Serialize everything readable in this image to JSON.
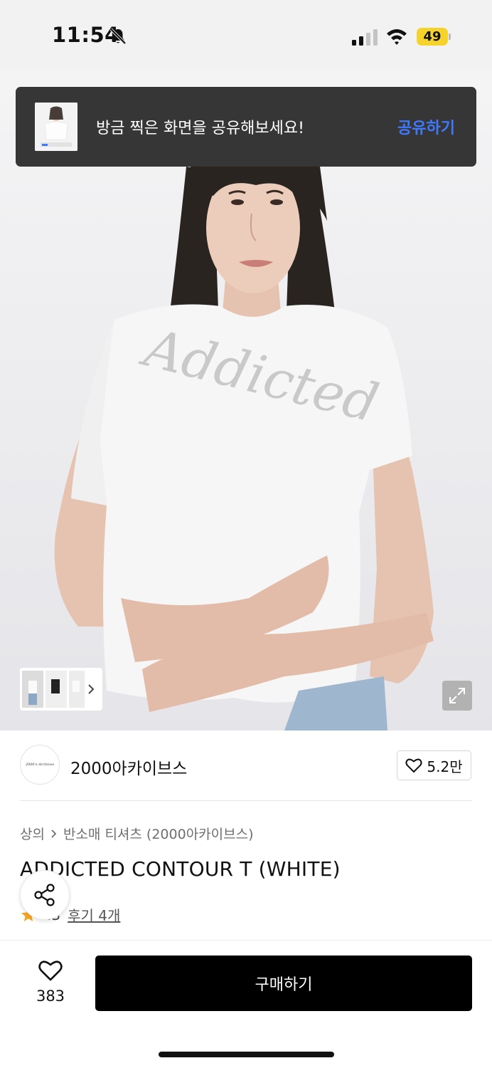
{
  "status_bar": {
    "time": "11:54",
    "battery": "49",
    "icons": [
      "bell-slash-icon",
      "signal-icon",
      "wifi-icon",
      "battery-icon"
    ]
  },
  "toast": {
    "message": "방금 찍은 화면을 공유해보세요!",
    "action_label": "공유하기",
    "action_color": "#3f79ff"
  },
  "product_image": {
    "shirt_script": "Addicted",
    "icons": [
      "expand-icon",
      "chevron-right-icon"
    ]
  },
  "brand": {
    "name": "2000아카이브스",
    "logo_text": "2000's Archives",
    "likes": "5.2만"
  },
  "product": {
    "breadcrumb": [
      "상의",
      "반소매 티셔츠 (2000아카이브스)"
    ],
    "title": "ADDICTED CONTOUR T (WHITE)",
    "rating_fragment": ".3",
    "reviews_label": "후기 4개",
    "star_color": "#f5a623"
  },
  "bottom_bar": {
    "wish_count": "383",
    "buy_label": "구매하기"
  }
}
